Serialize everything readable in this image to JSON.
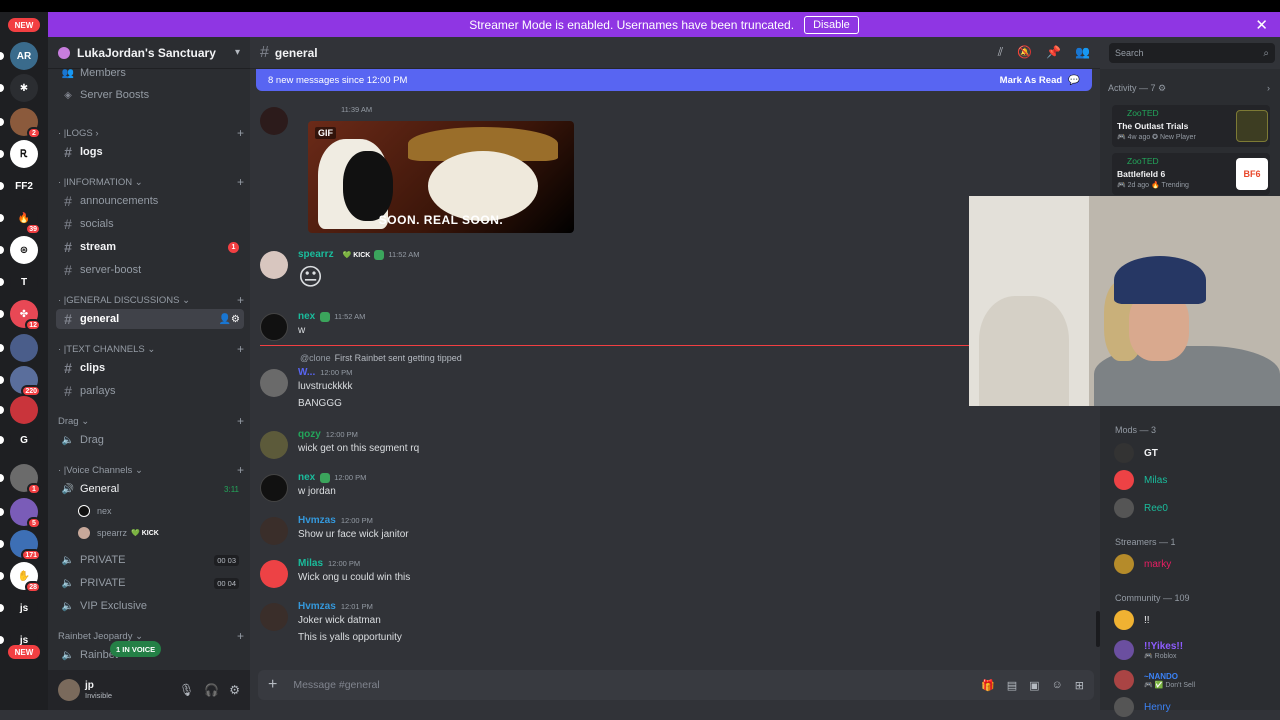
{
  "banner": {
    "text": "Streamer Mode is enabled. Usernames have been truncated.",
    "button": "Disable",
    "close": "✕"
  },
  "guilds": {
    "new_top": "NEW",
    "new_bottom": "NEW",
    "items": [
      {
        "name": "AR",
        "color": "#3a6b8c",
        "badge": ""
      },
      {
        "name": "✱",
        "color": "#2b2d31",
        "badge": ""
      },
      {
        "name": "",
        "color": "#8b5a3c",
        "badge": "2"
      },
      {
        "name": "Ꭱ",
        "color": "#ffffff",
        "badge": ""
      },
      {
        "name": "FF2",
        "color": "#1e1f22",
        "badge": ""
      },
      {
        "name": "🔥",
        "color": "#1e1f22",
        "badge": "39"
      },
      {
        "name": "⊛",
        "color": "#ffffff",
        "badge": ""
      },
      {
        "name": "T",
        "color": "#1e1f22",
        "badge": ""
      },
      {
        "name": "✤",
        "color": "#e84855",
        "badge": "12"
      },
      {
        "name": "",
        "color": "#4a5d8a",
        "badge": ""
      },
      {
        "name": "",
        "color": "#5a6e9c",
        "badge": "220"
      },
      {
        "name": "",
        "color": "#c9343b",
        "badge": ""
      },
      {
        "name": "G",
        "color": "#1e1f22",
        "badge": ""
      },
      {
        "name": "",
        "color": "#6b6b6b",
        "badge": "1"
      },
      {
        "name": "",
        "color": "#7a5cb8",
        "badge": "5"
      },
      {
        "name": "",
        "color": "#3d6fb5",
        "badge": "171"
      },
      {
        "name": "✋",
        "color": "#ffffff",
        "badge": "28"
      },
      {
        "name": "js",
        "color": "#1e1f22",
        "badge": ""
      },
      {
        "name": "js",
        "color": "#1e1f22",
        "badge": ""
      }
    ]
  },
  "server": {
    "name": "LukaJordan's Sanctuary"
  },
  "channels": {
    "top": [
      {
        "label": "Members",
        "icon": "👥"
      },
      {
        "label": "Server Boosts",
        "icon": "◈"
      }
    ],
    "logs_cat": "LOGS",
    "logs": "logs",
    "info_cat": "INFORMATION",
    "info": [
      "announcements",
      "socials",
      "stream",
      "server-boost"
    ],
    "stream_badge": "1",
    "gen_cat": "GENERAL DISCUSSIONS",
    "general": "general",
    "text_cat": "TEXT CHANNELS",
    "text": [
      "clips",
      "parlays"
    ],
    "drag_cat": "Drag",
    "drag": "Drag",
    "voice_cat": "Voice Channels",
    "voice_general": "General",
    "voice_timer": "3:11",
    "voice_users": [
      {
        "name": "nex",
        "kick": ""
      },
      {
        "name": "spearrz",
        "kick": "KICK"
      }
    ],
    "private1": "PRIVATE",
    "private1_count": "00 03",
    "private2": "PRIVATE",
    "private2_count": "00 04",
    "vip": "VIP Exclusive",
    "rb_cat": "Rainbet Jeopardy",
    "rb": "Rainbet",
    "in_voice": "1 IN VOICE"
  },
  "user": {
    "name": "jp",
    "status": "Invisible"
  },
  "chat": {
    "channel": "general",
    "new_bar": "8 new messages since 12:00 PM",
    "mark_read": "Mark As Read",
    "messages": [
      {
        "user": "",
        "color": "#5865f2",
        "time": "11:39 AM",
        "lines": []
      },
      {
        "user": "spearrz",
        "color": "#1abc9c",
        "time": "11:52 AM",
        "lines": [
          "😐"
        ],
        "kick": "KICK"
      },
      {
        "user": "nex",
        "color": "#1abc9c",
        "time": "11:52 AM",
        "lines": [
          "w"
        ]
      },
      {
        "user": "W...",
        "color": "#5865f2",
        "time": "12:00 PM",
        "lines": [
          "luvstruckkkk",
          "BANGGG"
        ]
      },
      {
        "user": "qozy",
        "color": "#23a55a",
        "time": "12:00 PM",
        "lines": [
          "wick get on this segment rq"
        ]
      },
      {
        "user": "nex",
        "color": "#1abc9c",
        "time": "12:00 PM",
        "lines": [
          "w jordan"
        ]
      },
      {
        "user": "Hvmzas",
        "color": "#3498db",
        "time": "12:00 PM",
        "lines": [
          "Show ur face wick janitor"
        ]
      },
      {
        "user": "Milas",
        "color": "#1abc9c",
        "time": "12:00 PM",
        "lines": [
          "Wick ong u could win this"
        ]
      },
      {
        "user": "Hvmzas",
        "color": "#3498db",
        "time": "12:01 PM",
        "lines": [
          "Joker wick datman",
          "This is yalls opportunity"
        ]
      }
    ],
    "gif_label": "GIF",
    "gif_caption": "SOON. REAL SOON.",
    "reply_at": "@clone",
    "reply_text": "First Rainbet sent getting tipped",
    "placeholder": "Message #general"
  },
  "search": {
    "placeholder": "Search"
  },
  "members": {
    "activity_head": "Activity — 7",
    "activities": [
      {
        "user": "ZooTED",
        "game": "The Outlast Trials",
        "meta": "🎮 4w ago  ✪ New Player",
        "thumb_color": "#6a6a3a"
      },
      {
        "user": "ZooTED",
        "game": "Battlefield 6",
        "meta": "🎮 2d ago  🔥 Trending",
        "thumb_color": "#e8472a",
        "thumb_text": "BF6"
      }
    ],
    "mods_head": "Mods — 3",
    "mods": [
      {
        "name": "GT",
        "color": "#f2f3f5"
      },
      {
        "name": "Milas",
        "color": "#1abc9c"
      },
      {
        "name": "Ree0",
        "color": "#1abc9c"
      }
    ],
    "streamers_head": "Streamers — 1",
    "streamers": [
      {
        "name": "marky",
        "color": "#e91e63"
      }
    ],
    "community_head": "Community — 109",
    "community": [
      {
        "name": "!!",
        "color": "#f2f3f5",
        "sub": ""
      },
      {
        "name": "!!Yikes!!",
        "color": "#8e5cff",
        "sub": "🎮 Roblox"
      },
      {
        "name": "~NANDO",
        "color": "#3b82f6",
        "sub": "🎮 ✅ Don't Sell"
      },
      {
        "name": "Henry",
        "color": "#3b82f6",
        "sub": ""
      }
    ]
  }
}
